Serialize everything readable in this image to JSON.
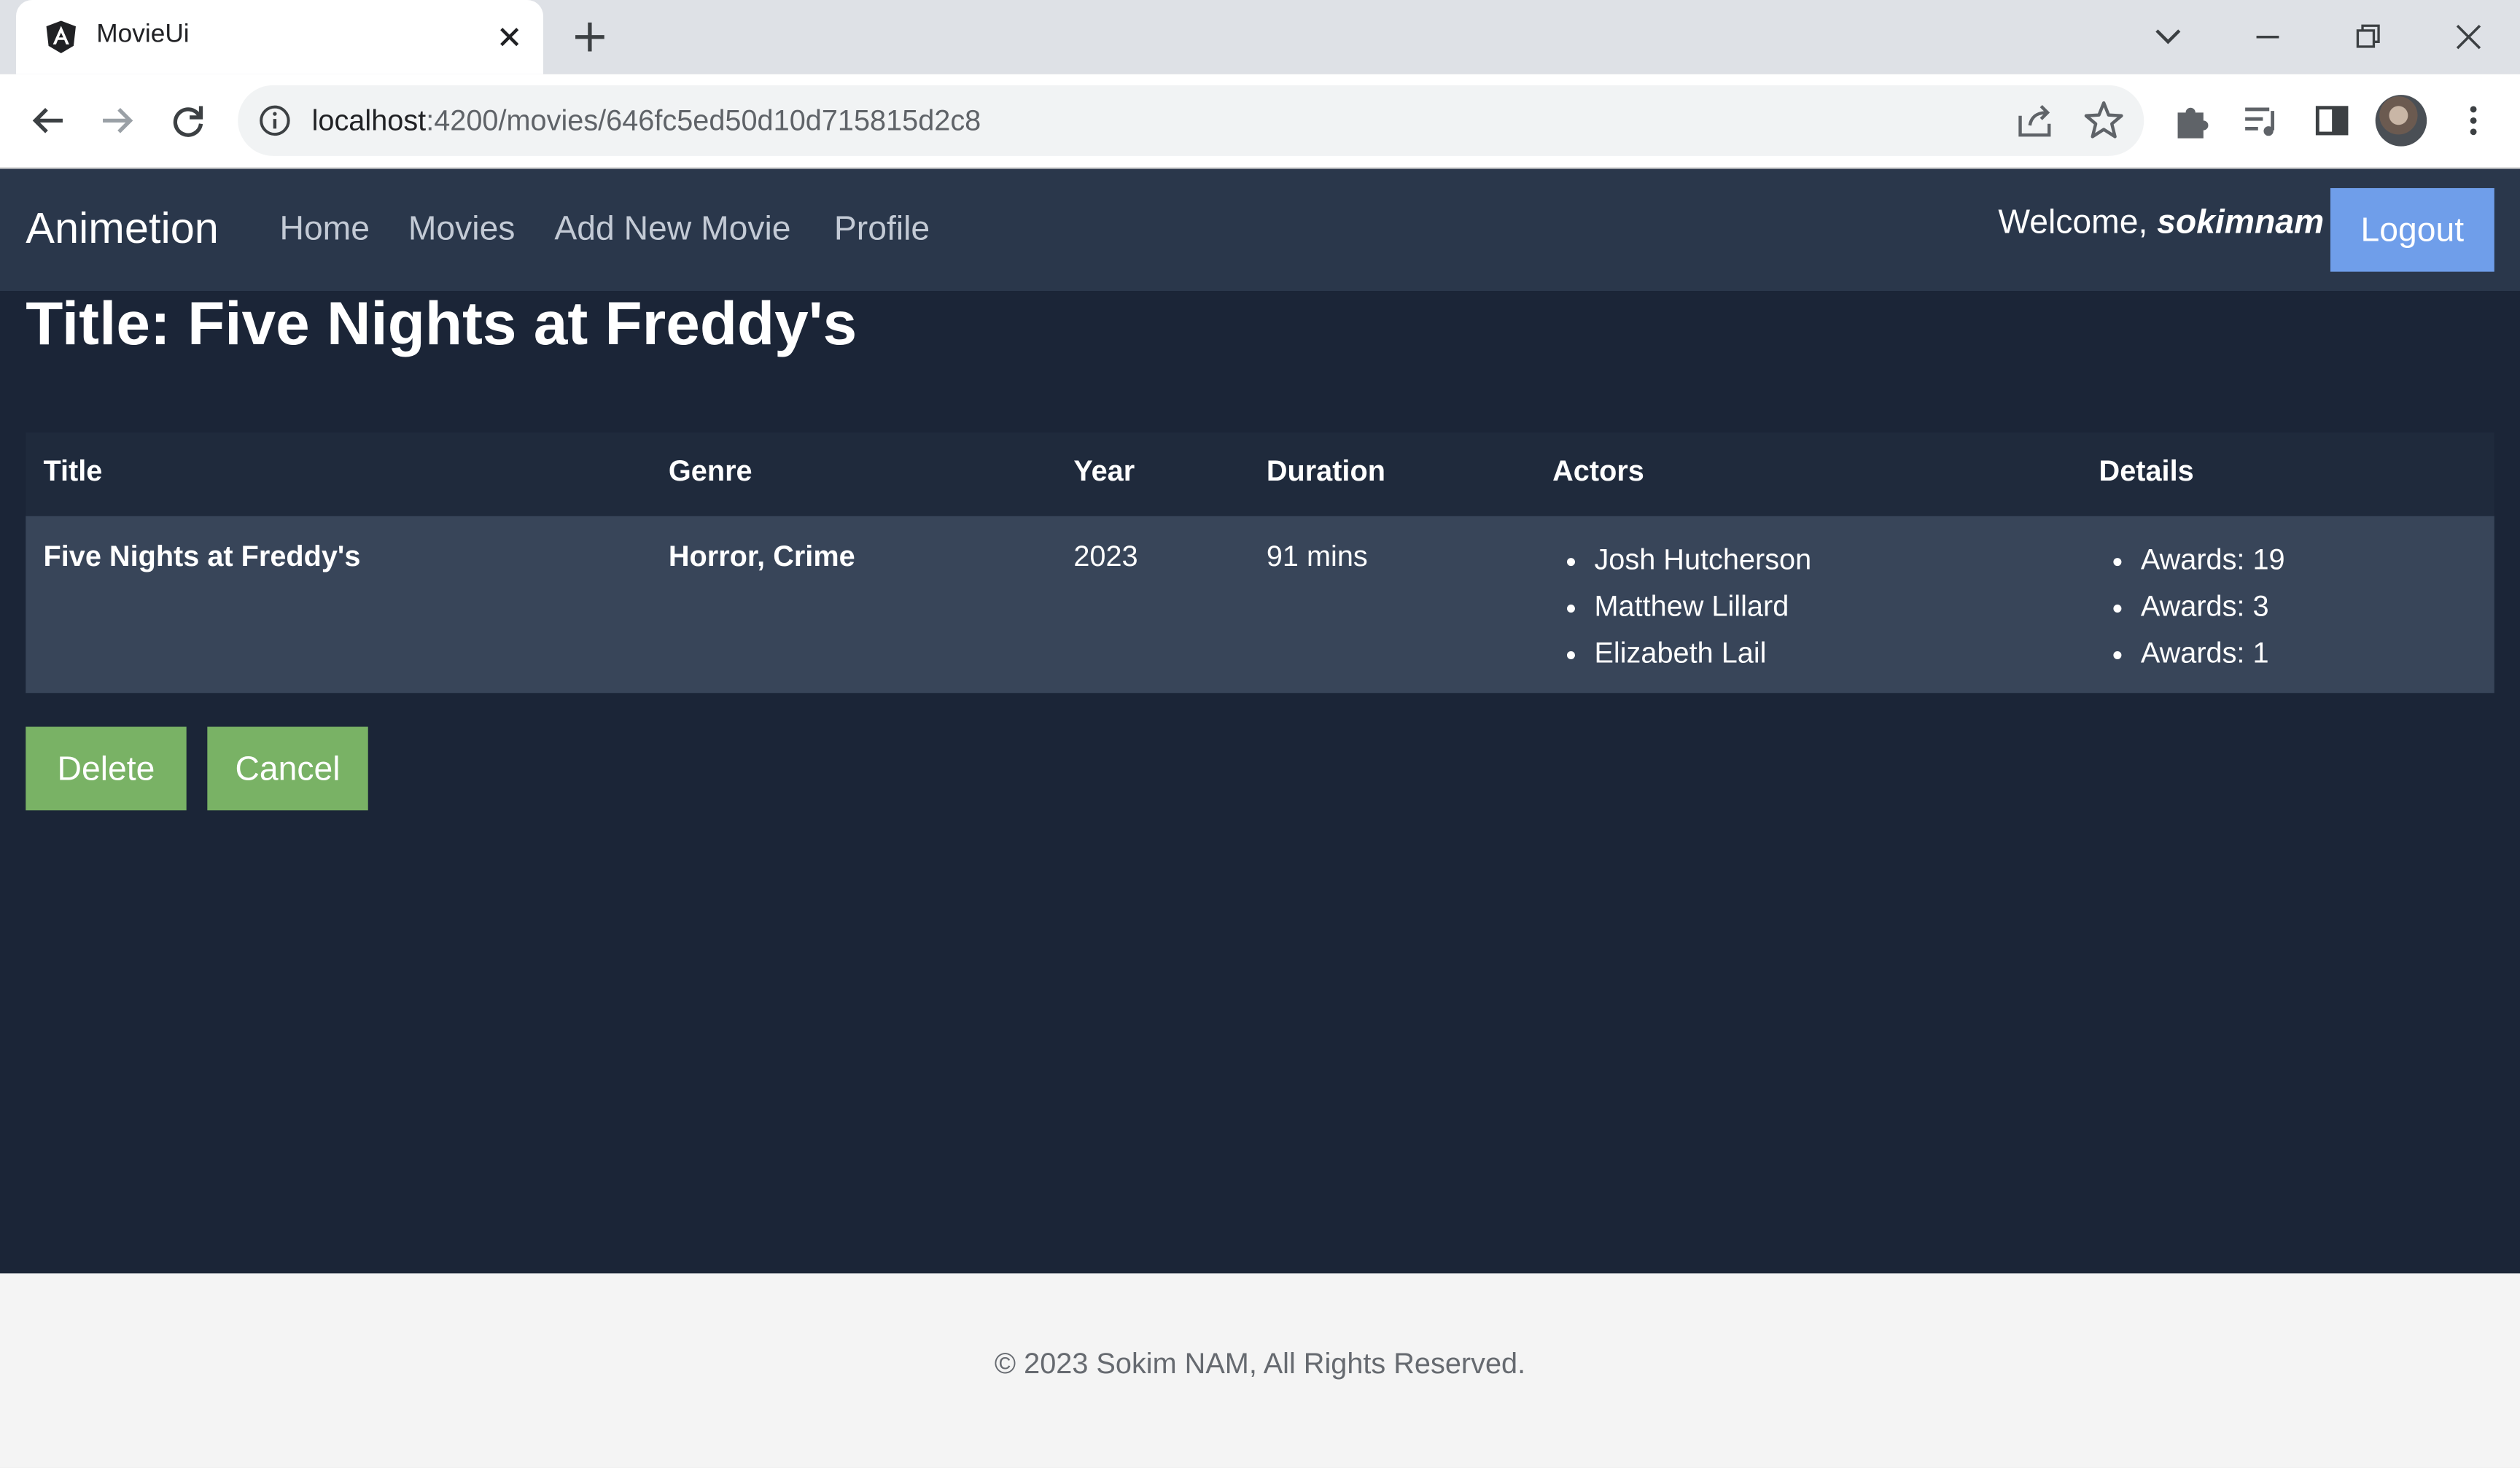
{
  "browser": {
    "tab_title": "MovieUi",
    "url_host": "localhost",
    "url_path": ":4200/movies/646fc5ed50d10d715815d2c8"
  },
  "navbar": {
    "brand": "Animetion",
    "links": [
      "Home",
      "Movies",
      "Add New Movie",
      "Profile"
    ],
    "welcome_prefix": "Welcome, ",
    "username": "sokimnam",
    "logout_label": "Logout"
  },
  "page": {
    "title": "Title: Five Nights at Freddy's"
  },
  "table": {
    "headers": [
      "Title",
      "Genre",
      "Year",
      "Duration",
      "Actors",
      "Details"
    ],
    "row": {
      "title": "Five Nights at Freddy's",
      "genre": "Horror, Crime",
      "year": "2023",
      "duration": "91 mins",
      "actors": [
        "Josh Hutcherson",
        "Matthew Lillard",
        "Elizabeth Lail"
      ],
      "details": [
        "Awards: 19",
        "Awards: 3",
        "Awards: 1"
      ]
    }
  },
  "actions": {
    "delete_label": "Delete",
    "cancel_label": "Cancel"
  },
  "footer": {
    "text": "© 2023 Sokim NAM, All Rights Reserved."
  },
  "colors": {
    "navbar_bg": "#2a374b",
    "page_bg": "#1b2537",
    "logout_bg": "#6f9eea",
    "action_bg": "#79b265"
  }
}
